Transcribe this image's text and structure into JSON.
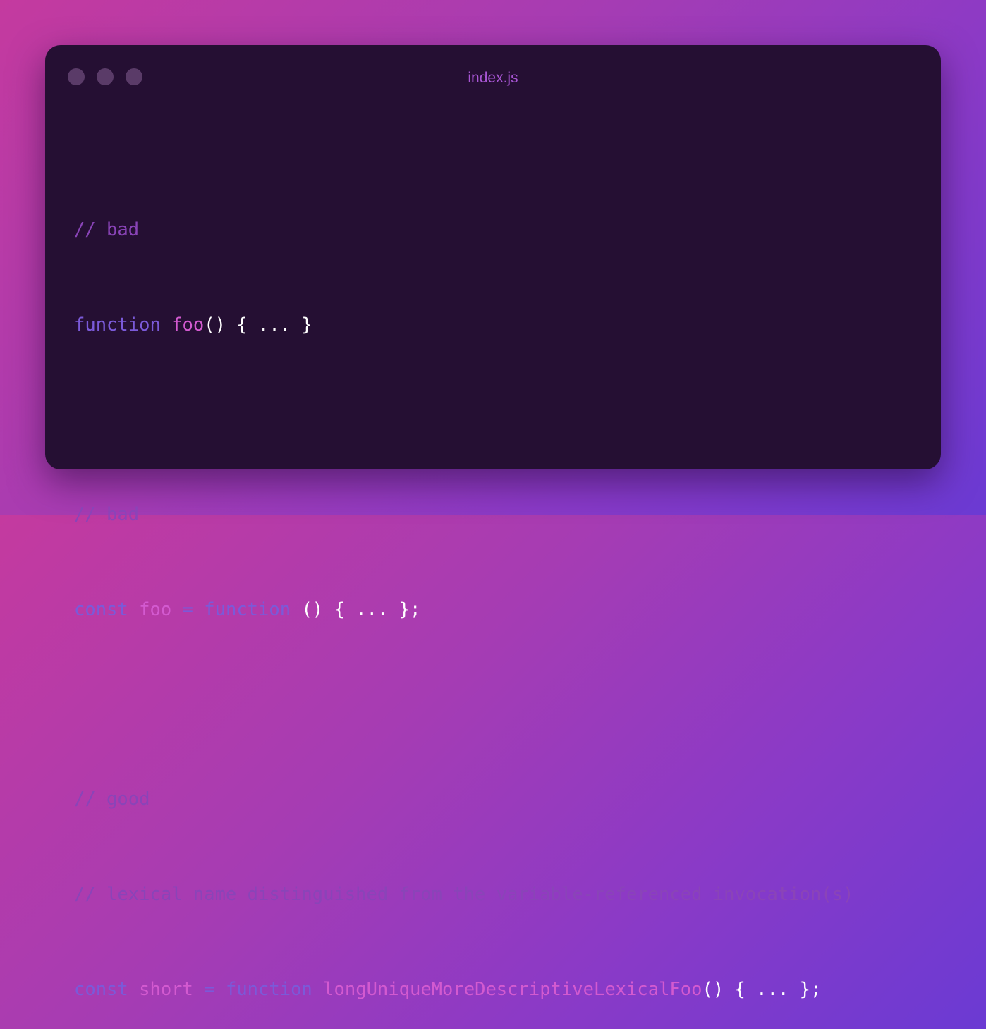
{
  "window": {
    "title": "index.js",
    "traffic_lights": [
      "close-dot",
      "minimize-dot",
      "maximize-dot"
    ]
  },
  "code": {
    "block1": {
      "comment": "// bad",
      "kw1": "function",
      "name": "foo",
      "rest": "() { ... }"
    },
    "block2": {
      "comment": "// bad",
      "kw1": "const",
      "name": "foo",
      "op": "=",
      "kw2": "function",
      "rest": "() { ... };"
    },
    "block3": {
      "comment1": "// good",
      "comment2": "// lexical name distinguished from the variable-referenced invocation(s)",
      "kw1": "const",
      "name": "short",
      "op": "=",
      "kw2": "function",
      "fname": "longUniqueMoreDescriptiveLexicalFoo",
      "rest": "() { ... };"
    }
  },
  "colors": {
    "background_start": "#c43a9f",
    "background_end": "#6b3ad3",
    "window_bg": "#250f33",
    "comment": "#8a44b8",
    "keyword": "#7b5ad9",
    "identifier": "#d35ad0",
    "punctuation": "#ffffff",
    "title": "#a855d4"
  }
}
